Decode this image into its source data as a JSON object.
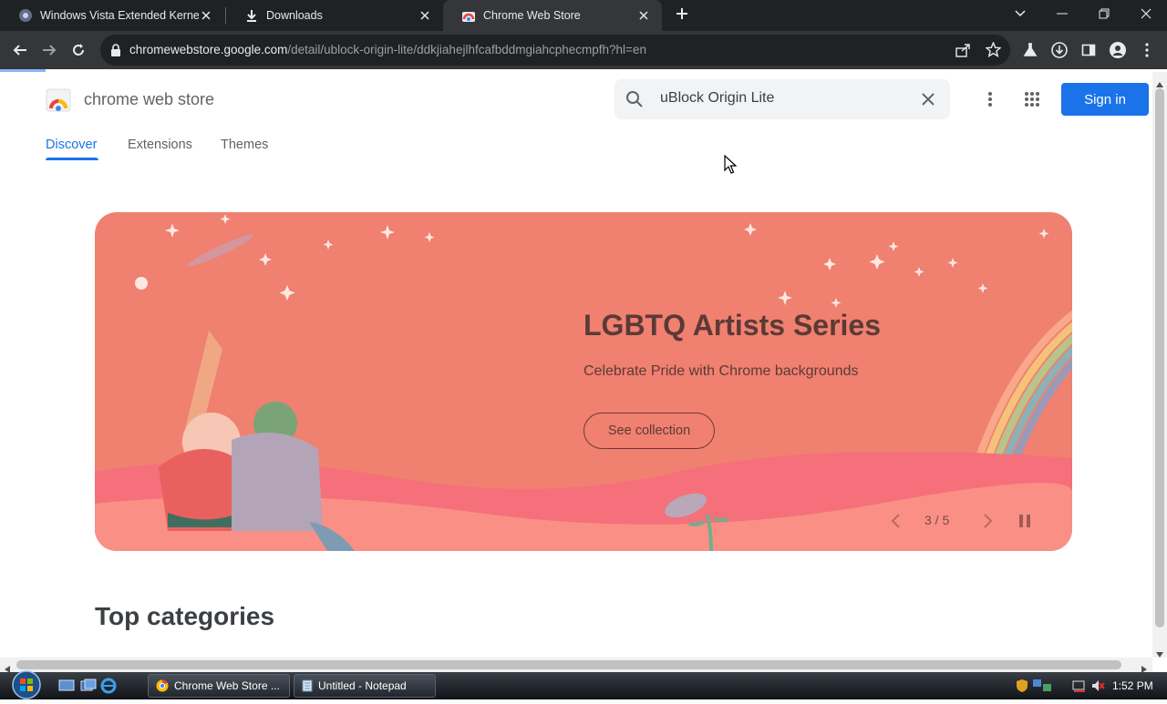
{
  "browser": {
    "tabs": [
      {
        "title": "Windows Vista Extended Kernel",
        "active": false
      },
      {
        "title": "Downloads",
        "active": false
      },
      {
        "title": "Chrome Web Store",
        "active": true
      }
    ],
    "url_host": "chromewebstore.google.com",
    "url_path": "/detail/ublock-origin-lite/ddkjiahejlhfcafbddmgiahcphecmpfh?hl=en"
  },
  "store": {
    "title": "chrome web store",
    "search_value": "uBlock Origin Lite",
    "signin_label": "Sign in",
    "nav": [
      "Discover",
      "Extensions",
      "Themes"
    ],
    "banner": {
      "title": "LGBTQ Artists Series",
      "subtitle": "Celebrate Pride with Chrome backgrounds",
      "cta": "See collection",
      "counter": "3 / 5"
    },
    "section_title": "Top categories"
  },
  "taskbar": {
    "items": [
      "Chrome Web Store ...",
      "Untitled - Notepad"
    ],
    "clock": "1:52 PM"
  },
  "colors": {
    "accent": "#1a73e8",
    "banner": "#f08070",
    "chrome_dark": "#202124",
    "chrome_toolbar": "#35363a"
  }
}
